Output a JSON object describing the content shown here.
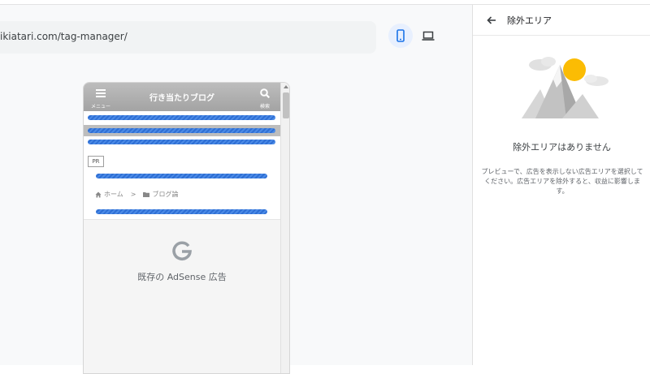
{
  "toolbar": {
    "url": "ikiatari.com/tag-manager/",
    "mobile_icon": "mobile-phone-icon",
    "desktop_icon": "laptop-icon"
  },
  "preview": {
    "menu_label": "メニュー",
    "site_title": "行き当たりブログ",
    "search_label": "検索",
    "pr_badge": "PR",
    "breadcrumb": {
      "home": "ホーム",
      "separator": ">",
      "category": "ブログ論"
    },
    "ad_placeholder": "既存の AdSense 広告"
  },
  "panel": {
    "title": "除外エリア",
    "empty_title": "除外エリアはありません",
    "empty_description": "プレビューで、広告を表示しない広告エリアを選択してください。広告エリアを除外すると、収益に影響します。"
  },
  "colors": {
    "accent": "#1a73e8",
    "stripe": "#4a8ae6",
    "sun": "#fbbc04",
    "header_gray": "#b0b0b0"
  }
}
